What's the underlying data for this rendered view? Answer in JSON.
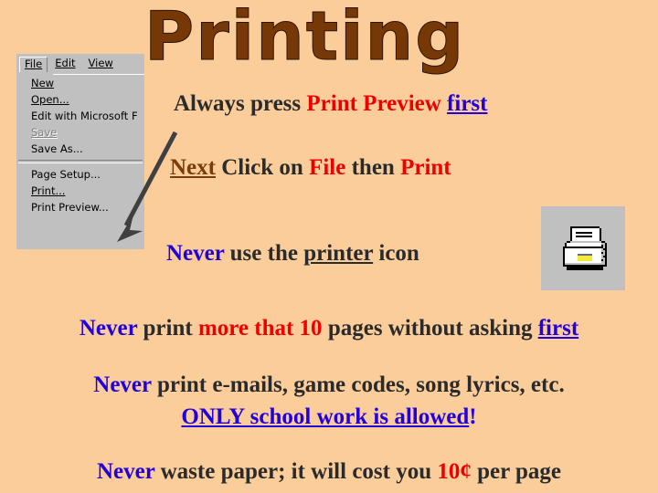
{
  "slide": {
    "background_color": "#facd9a",
    "title": "Printing"
  },
  "menu": {
    "menubar": [
      {
        "label": "File",
        "accel": "F",
        "state": "open"
      },
      {
        "label": "Edit",
        "accel": "E",
        "state": "normal"
      },
      {
        "label": "View",
        "accel": "V",
        "state": "normal"
      }
    ],
    "items": [
      {
        "label": "New",
        "accel": "N",
        "state": "enabled"
      },
      {
        "label": "Open...",
        "accel": "O",
        "state": "enabled"
      },
      {
        "label": "Edit with Microsoft F",
        "accel": "d",
        "state": "enabled"
      },
      {
        "label": "Save",
        "accel": "S",
        "state": "disabled"
      },
      {
        "label": "Save As...",
        "accel": "A",
        "state": "enabled"
      },
      {
        "label": "Page Setup...",
        "accel": "u",
        "state": "enabled"
      },
      {
        "label": "Print...",
        "accel": "P",
        "state": "enabled"
      },
      {
        "label": "Print Preview...",
        "accel": "v",
        "state": "enabled"
      }
    ]
  },
  "lines": {
    "always": {
      "part1": "Always press ",
      "part2": "Print Preview ",
      "part3": "first"
    },
    "next": {
      "part1": "Next",
      "part2": " Click on ",
      "part3": "File",
      "part4": " then ",
      "part5": "Print"
    },
    "never_icon": {
      "part1": "Never",
      "part2": " use the ",
      "part3": "printer",
      "part4": " icon"
    },
    "pages": {
      "part1": "Never",
      "part2": " print ",
      "part3": "more that 10",
      "part4": " pages without asking ",
      "part5": "first"
    },
    "emails": {
      "part1": "Never",
      "part2": " print e-mails, game codes, song lyrics, etc."
    },
    "only": {
      "part1": "ONLY school work is allowed",
      "part2": "!"
    },
    "waste": {
      "part1": "Never",
      "part2": " waste paper; it will cost you ",
      "part3": "10¢",
      "part4": " per page"
    }
  },
  "icons": {
    "printer": "printer-icon",
    "arrow": "arrow-pointer-icon"
  },
  "colors": {
    "title_brown": "#773808",
    "red": "#ee0000",
    "blue": "#2200dd",
    "brown": "#7a3c0a",
    "dark_text": "#2b2b2b",
    "menu_face": "#c0c0c0"
  }
}
